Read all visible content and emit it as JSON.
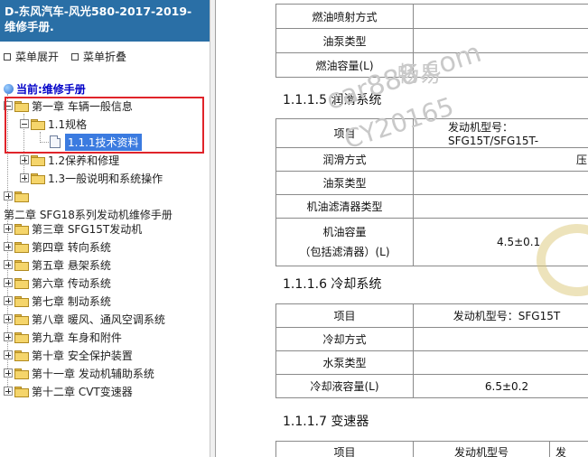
{
  "left_panel": {
    "title": "D-东风汽车-风光580-2017-2019- 维修手册.",
    "expand_all": "菜单展开",
    "collapse_all": "菜单折叠",
    "current_label": "当前:维修手册",
    "tree": {
      "ch1": "第一章 车辆一般信息",
      "ch1_1": "1.1规格",
      "ch1_1_1": "1.1.1技术资料",
      "ch1_2": "1.2保养和修理",
      "ch1_3": "1.3一般说明和系统操作",
      "ch2": "第二章 SFG18系列发动机维修手册",
      "ch3": "第三章 SFG15T发动机",
      "ch4": "第四章 转向系统",
      "ch5": "第五章 悬架系统",
      "ch6": "第六章 传动系统",
      "ch7": "第七章 制动系统",
      "ch8": "第八章 暖风、通风空调系统",
      "ch9": "第九章 车身和附件",
      "ch10": "第十章 安全保护装置",
      "ch11": "第十一章 发动机辅助系统",
      "ch12": "第十二章 CVT变速器"
    }
  },
  "content": {
    "fuel_table": {
      "rows": [
        "燃油喷射方式",
        "油泵类型",
        "燃油容量(L)"
      ]
    },
    "sec_lube": "1.1.1.5  润滑系统",
    "lube_table": {
      "header_item": "项目",
      "header_value": "发动机型号：SFG15T/SFG15T-",
      "rows": [
        "润滑方式",
        "油泵类型",
        "机油滤清器类型",
        "机油容量",
        "（包括滤清器）(L)"
      ],
      "value_first": "压",
      "value_capacity": "4.5±0.1"
    },
    "sec_cool": "1.1.1.6  冷却系统",
    "cool_table": {
      "header_item": "项目",
      "header_value": "发动机型号：SFG15T",
      "rows": [
        "冷却方式",
        "水泵类型",
        "冷却液容量(L)"
      ],
      "value_capacity": "6.5±0.2"
    },
    "sec_trans": "1.1.1.7  变速器",
    "trans_table": {
      "header_item": "项目",
      "header_value": "发动机型号",
      "header_value2": "发"
    }
  },
  "watermark": {
    "line1": "畅易",
    "line2": "car888.com",
    "line3": "CY20165"
  }
}
